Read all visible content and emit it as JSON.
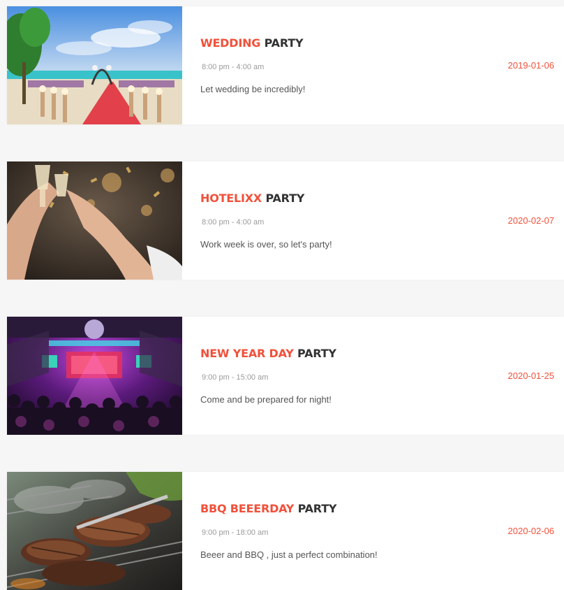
{
  "events": [
    {
      "title_accent": "WEDDING",
      "title_rest": "PARTY",
      "time": "8:00 pm - 4:00 am",
      "description": "Let wedding be incredibly!",
      "date": "2019-01-06",
      "image": "beach-wedding-photo"
    },
    {
      "title_accent": "HOTELIXX",
      "title_rest": "PARTY",
      "time": "8:00 pm - 4:00 am",
      "description": "Work week is over, so let's party!",
      "date": "2020-02-07",
      "image": "champagne-toast-photo"
    },
    {
      "title_accent": "NEW YEAR DAY",
      "title_rest": "PARTY",
      "time": "9:00 pm - 15:00 am",
      "description": "Come and be prepared for night!",
      "date": "2020-01-25",
      "image": "nightclub-concert-photo"
    },
    {
      "title_accent": "BBQ BEEERDAY",
      "title_rest": "PARTY",
      "time": "9:00 pm - 18:00 am",
      "description": "Beeer and BBQ , just a perfect combination!",
      "date": "2020-02-06",
      "image": "bbq-grill-photo"
    }
  ],
  "colors": {
    "accent": "#f0513b",
    "heading": "#333333",
    "muted": "#9a9a9a",
    "body_text": "#555555",
    "page_background": "#f6f6f6",
    "card_background": "#ffffff"
  }
}
